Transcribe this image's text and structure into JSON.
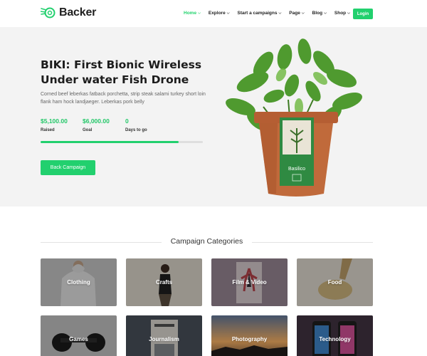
{
  "brand": {
    "name": "Backer",
    "accent": "#22d06e"
  },
  "nav": {
    "items": [
      {
        "label": "Home",
        "active": true
      },
      {
        "label": "Explore",
        "active": false
      },
      {
        "label": "Start a campaigns",
        "active": false
      },
      {
        "label": "Page",
        "active": false
      },
      {
        "label": "Blog",
        "active": false
      },
      {
        "label": "Shop",
        "active": false
      }
    ],
    "login_label": "Login"
  },
  "hero": {
    "title": "BIKI: First Bionic Wireless Under water Fish Drone",
    "description": "Corned beef leberkas fatback porchetta, strip steak salami turkey short loin flank ham hock landjaeger. Leberkas pork belly",
    "stats": [
      {
        "value": "$5,100.00",
        "label": "Raised"
      },
      {
        "value": "$6,000.00",
        "label": "Goal"
      },
      {
        "value": "0",
        "label": "Days to go"
      }
    ],
    "progress_percent": 85,
    "cta_label": "Back Campaign",
    "plant_tag": "Basilico"
  },
  "categories": {
    "title": "Campaign Categories",
    "items": [
      {
        "label": "Clothing",
        "icon": "clothing-photo"
      },
      {
        "label": "Crafts",
        "icon": "crafts-photo"
      },
      {
        "label": "Film & Video",
        "icon": "film-photo"
      },
      {
        "label": "Food",
        "icon": "food-photo"
      },
      {
        "label": "Games",
        "icon": "games-photo"
      },
      {
        "label": "Journalism",
        "icon": "journalism-photo"
      },
      {
        "label": "Photography",
        "icon": "photography-photo"
      },
      {
        "label": "Technology",
        "icon": "technology-photo"
      }
    ]
  }
}
